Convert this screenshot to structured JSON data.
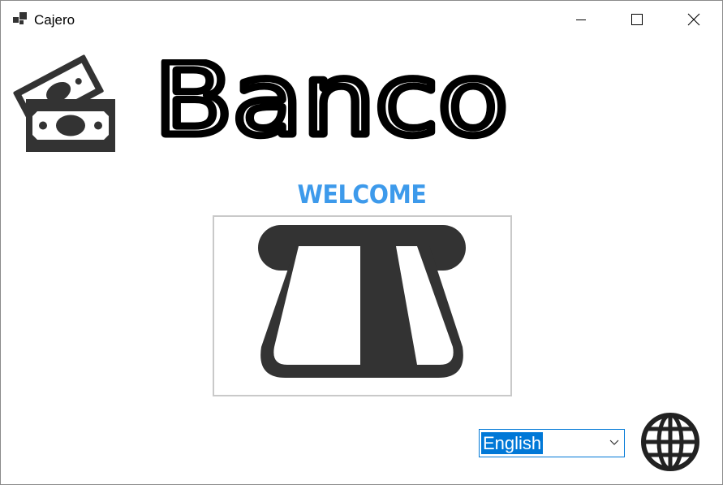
{
  "window": {
    "title": "Cajero",
    "controls": {
      "minimize_icon": "minimize-icon",
      "maximize_icon": "maximize-icon",
      "close_icon": "close-icon"
    }
  },
  "header": {
    "bank_name": "Banco",
    "logo_icon": "money-bills-icon"
  },
  "main": {
    "welcome_text": "WELCOME",
    "card_icon": "card-slot-icon"
  },
  "footer": {
    "language_select": {
      "selected": "English"
    },
    "language_icon": "globe-icon"
  },
  "colors": {
    "accent": "#3d9aeb",
    "icon_dark": "#333333",
    "selection": "#0078d7"
  }
}
